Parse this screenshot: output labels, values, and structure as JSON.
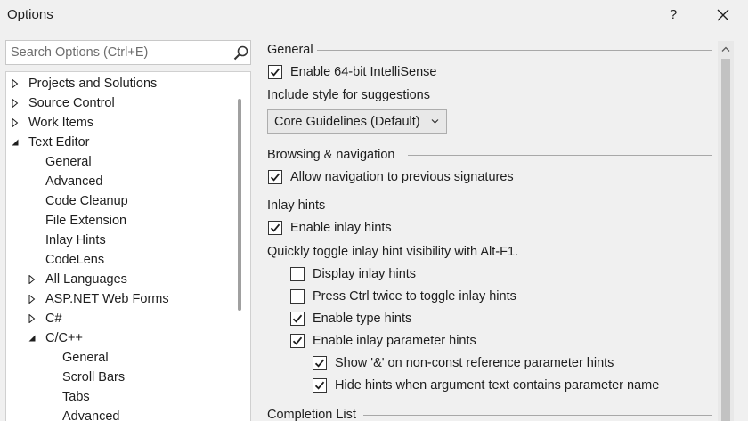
{
  "window": {
    "title": "Options",
    "help_label": "?"
  },
  "search": {
    "placeholder": "Search Options (Ctrl+E)",
    "value": ""
  },
  "tree": {
    "items": [
      {
        "label": "Projects and Solutions",
        "level": 0,
        "toggle": "collapsed"
      },
      {
        "label": "Source Control",
        "level": 0,
        "toggle": "collapsed"
      },
      {
        "label": "Work Items",
        "level": 0,
        "toggle": "collapsed"
      },
      {
        "label": "Text Editor",
        "level": 0,
        "toggle": "expanded"
      },
      {
        "label": "General",
        "level": 1,
        "toggle": "none"
      },
      {
        "label": "Advanced",
        "level": 1,
        "toggle": "none"
      },
      {
        "label": "Code Cleanup",
        "level": 1,
        "toggle": "none"
      },
      {
        "label": "File Extension",
        "level": 1,
        "toggle": "none"
      },
      {
        "label": "Inlay Hints",
        "level": 1,
        "toggle": "none"
      },
      {
        "label": "CodeLens",
        "level": 1,
        "toggle": "none"
      },
      {
        "label": "All Languages",
        "level": 1,
        "toggle": "collapsed"
      },
      {
        "label": "ASP.NET Web Forms",
        "level": 1,
        "toggle": "collapsed"
      },
      {
        "label": "C#",
        "level": 1,
        "toggle": "collapsed"
      },
      {
        "label": "C/C++",
        "level": 1,
        "toggle": "expanded"
      },
      {
        "label": "General",
        "level": 2,
        "toggle": "none"
      },
      {
        "label": "Scroll Bars",
        "level": 2,
        "toggle": "none"
      },
      {
        "label": "Tabs",
        "level": 2,
        "toggle": "none"
      },
      {
        "label": "Advanced",
        "level": 2,
        "toggle": "none"
      }
    ]
  },
  "general": {
    "title": "General",
    "enable_64bit": {
      "label": "Enable 64-bit IntelliSense",
      "checked": true
    },
    "style_label": "Include style for suggestions",
    "style_value": "Core Guidelines (Default)"
  },
  "browsing": {
    "title": "Browsing & navigation",
    "allow_nav": {
      "label": "Allow navigation to previous signatures",
      "checked": true
    }
  },
  "inlay": {
    "title": "Inlay hints",
    "enable": {
      "label": "Enable inlay hints",
      "checked": true
    },
    "toggle_text": "Quickly toggle inlay hint visibility with Alt-F1.",
    "display": {
      "label": "Display inlay hints",
      "checked": false
    },
    "ctrl_twice": {
      "label": "Press Ctrl twice to toggle inlay hints",
      "checked": false
    },
    "type_hints": {
      "label": "Enable type hints",
      "checked": true
    },
    "param_hints": {
      "label": "Enable inlay parameter hints",
      "checked": true
    },
    "show_amp": {
      "label": "Show '&' on non-const reference parameter hints",
      "checked": true
    },
    "hide_match": {
      "label": "Hide hints when argument text contains parameter name",
      "checked": true
    }
  },
  "completion": {
    "title": "Completion List"
  },
  "colors": {
    "window_bg": "#f0f0f0",
    "panel_bg": "#ffffff",
    "text": "#1e1e1e",
    "border": "#adadad"
  }
}
